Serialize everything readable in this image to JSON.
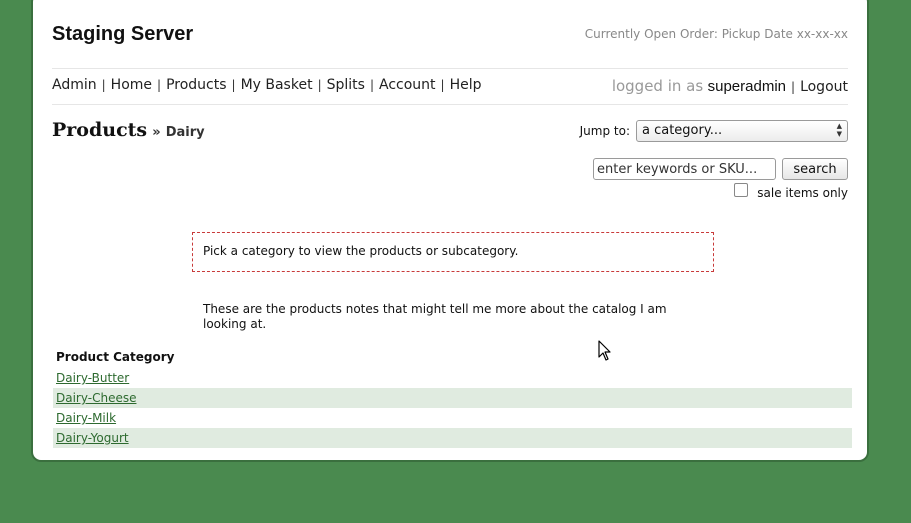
{
  "site": {
    "title": "Staging Server",
    "order_info": "Currently Open Order: Pickup Date xx-xx-xx"
  },
  "nav": {
    "items": [
      {
        "label": "Admin"
      },
      {
        "label": "Home"
      },
      {
        "label": "Products"
      },
      {
        "label": "My Basket"
      },
      {
        "label": "Splits"
      },
      {
        "label": "Account"
      },
      {
        "label": "Help"
      }
    ],
    "separator": "|"
  },
  "user": {
    "logged_in_label": "logged in as",
    "username": "superadmin",
    "logout_label": "Logout"
  },
  "page": {
    "heading": "Products",
    "breadcrumb_sep": "»",
    "subheading": "Dairy"
  },
  "jump": {
    "label": "Jump to:",
    "selected": "a category..."
  },
  "search": {
    "placeholder": "enter keywords or SKU...",
    "button_label": "search",
    "sale_label": "sale items only",
    "sale_checked": false
  },
  "notice": {
    "text": "Pick a category to view the products or subcategory."
  },
  "notes": {
    "text": "These are the products notes that might tell me more about the catalog I am looking at."
  },
  "categories": {
    "header": "Product Category",
    "items": [
      {
        "label": "Dairy-Butter"
      },
      {
        "label": "Dairy-Cheese"
      },
      {
        "label": "Dairy-Milk"
      },
      {
        "label": "Dairy-Yogurt"
      }
    ]
  },
  "colors": {
    "background": "#4a8a4f",
    "link_green": "#2d6a2f",
    "row_alt": "#e0ebe0",
    "notice_border": "#c83a3a"
  },
  "icons": {
    "select_arrows": "updown-arrows-icon",
    "cursor": "mouse-pointer-icon"
  }
}
